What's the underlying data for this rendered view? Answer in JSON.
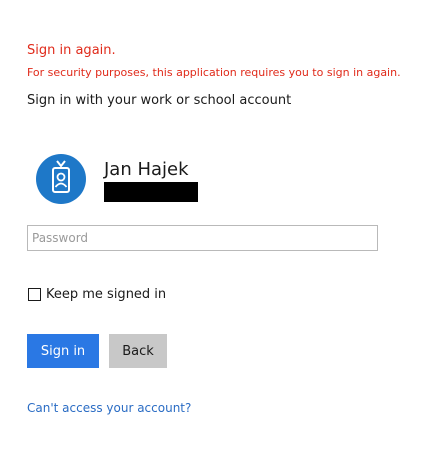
{
  "error": {
    "title": "Sign in again.",
    "message": "For security purposes, this application requires you to sign in again."
  },
  "heading": "Sign in with your work or school account",
  "account": {
    "name": "Jan Hajek",
    "avatar_icon": "user-badge-icon",
    "avatar_color": "#1e78c8"
  },
  "password": {
    "placeholder": "Password",
    "value": ""
  },
  "keep_signed_in": {
    "label": "Keep me signed in",
    "checked": false
  },
  "buttons": {
    "sign_in": "Sign in",
    "back": "Back"
  },
  "links": {
    "cant_access": "Can't access your account?"
  },
  "colors": {
    "error": "#e02a1a",
    "primary": "#2a78e4",
    "link": "#2a6cc4"
  }
}
